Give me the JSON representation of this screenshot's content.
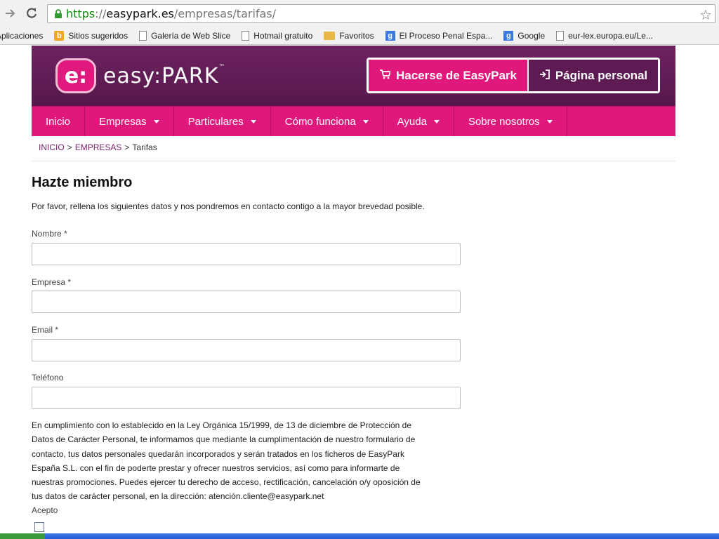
{
  "browser": {
    "url_scheme": "https",
    "url_sep": "://",
    "url_host": "easypark.es",
    "url_path": "/empresas/tarifas/",
    "bookmarks": [
      {
        "label": "Aplicaciones",
        "icon": "apps-icon"
      },
      {
        "label": "Sitios sugeridos",
        "icon": "bing-icon"
      },
      {
        "label": "Galería de Web Slice",
        "icon": "page-icon"
      },
      {
        "label": "Hotmail gratuito",
        "icon": "page-icon"
      },
      {
        "label": "Favoritos",
        "icon": "folder-icon"
      },
      {
        "label": "El Proceso Penal Espa...",
        "icon": "google-icon"
      },
      {
        "label": "Google",
        "icon": "google-icon"
      },
      {
        "label": "eur-lex.europa.eu/Le...",
        "icon": "page-icon"
      }
    ]
  },
  "header": {
    "logo_mark": "e:",
    "logo_text": "easy:PARK",
    "logo_tm": "™",
    "join_label": "Hacerse de EasyPark",
    "personal_label": "Página personal"
  },
  "nav": {
    "items": [
      {
        "label": "Inicio",
        "dropdown": false
      },
      {
        "label": "Empresas",
        "dropdown": true
      },
      {
        "label": "Particulares",
        "dropdown": true
      },
      {
        "label": "Cómo funciona",
        "dropdown": true
      },
      {
        "label": "Ayuda",
        "dropdown": true
      },
      {
        "label": "Sobre nosotros",
        "dropdown": true
      }
    ]
  },
  "breadcrumb": {
    "home": "INICIO",
    "section": "EMPRESAS",
    "current": "Tarifas",
    "sep": ">"
  },
  "form": {
    "title": "Hazte miembro",
    "intro": "Por favor, rellena los siguientes datos y nos pondremos en contacto contigo a la mayor brevedad posible.",
    "fields": [
      {
        "label": "Nombre *",
        "value": ""
      },
      {
        "label": "Empresa *",
        "value": ""
      },
      {
        "label": "Email *",
        "value": ""
      },
      {
        "label": "Teléfono",
        "value": ""
      }
    ],
    "legal": [
      "En cumplimiento con lo establecido en la Ley Orgánica 15/1999, de 13 de diciembre de Protección de",
      "Datos de Carácter Personal, te informamos que mediante la cumplimentación de nuestro formulario de",
      "contacto, tus datos personales quedarán incorporados y serán tratados en los ficheros de EasyPark",
      "España S.L. con el fin de poderte prestar y ofrecer nuestros servicios, así como para informarte de",
      "nuestras promociones. Puedes ejercer tu derecho de acceso, rectificación, cancelación o/y oposición de",
      "tus datos de carácter personal, en la dirección: atención.cliente@easypark.net"
    ],
    "accept_label": "Acepto",
    "accept_checked": false
  },
  "colors": {
    "brand_magenta": "#e0187c",
    "brand_purple": "#5e1a53",
    "link_purple": "#7a1f6e"
  }
}
